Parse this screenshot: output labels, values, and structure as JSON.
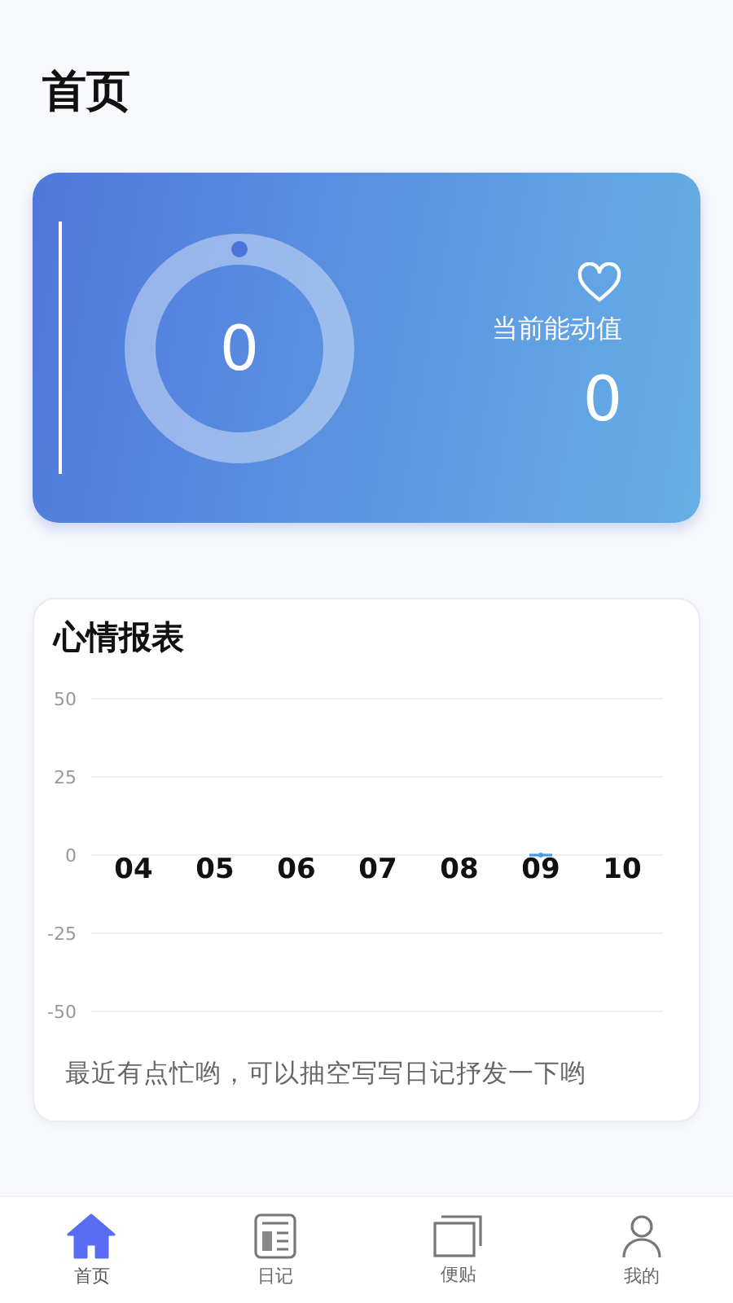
{
  "page_title": "首页",
  "energy_card": {
    "gauge": {
      "value": "0"
    },
    "label": "当前能动值",
    "value": "0"
  },
  "mood_chart": {
    "title": "心情报表",
    "chart_data": {
      "type": "line",
      "categories": [
        "04",
        "05",
        "06",
        "07",
        "08",
        "09",
        "10"
      ],
      "ylim": [
        -50,
        50
      ],
      "grid": true,
      "yticks": [
        50,
        25,
        0,
        -25,
        -50
      ],
      "series": [
        {
          "color": "#4a9be8",
          "marker": "circle",
          "values": [
            null,
            null,
            null,
            null,
            null,
            0,
            null
          ]
        }
      ]
    },
    "message": "最近有点忙哟，可以抽空写写日记抒发一下哟"
  },
  "tab_bar": [
    {
      "label": "首页",
      "kind": "home",
      "selected": true
    },
    {
      "label": "日记",
      "kind": "diary",
      "selected": false
    },
    {
      "label": "便贴",
      "kind": "notes",
      "selected": false
    },
    {
      "label": "我的",
      "kind": "profile",
      "selected": false
    }
  ]
}
